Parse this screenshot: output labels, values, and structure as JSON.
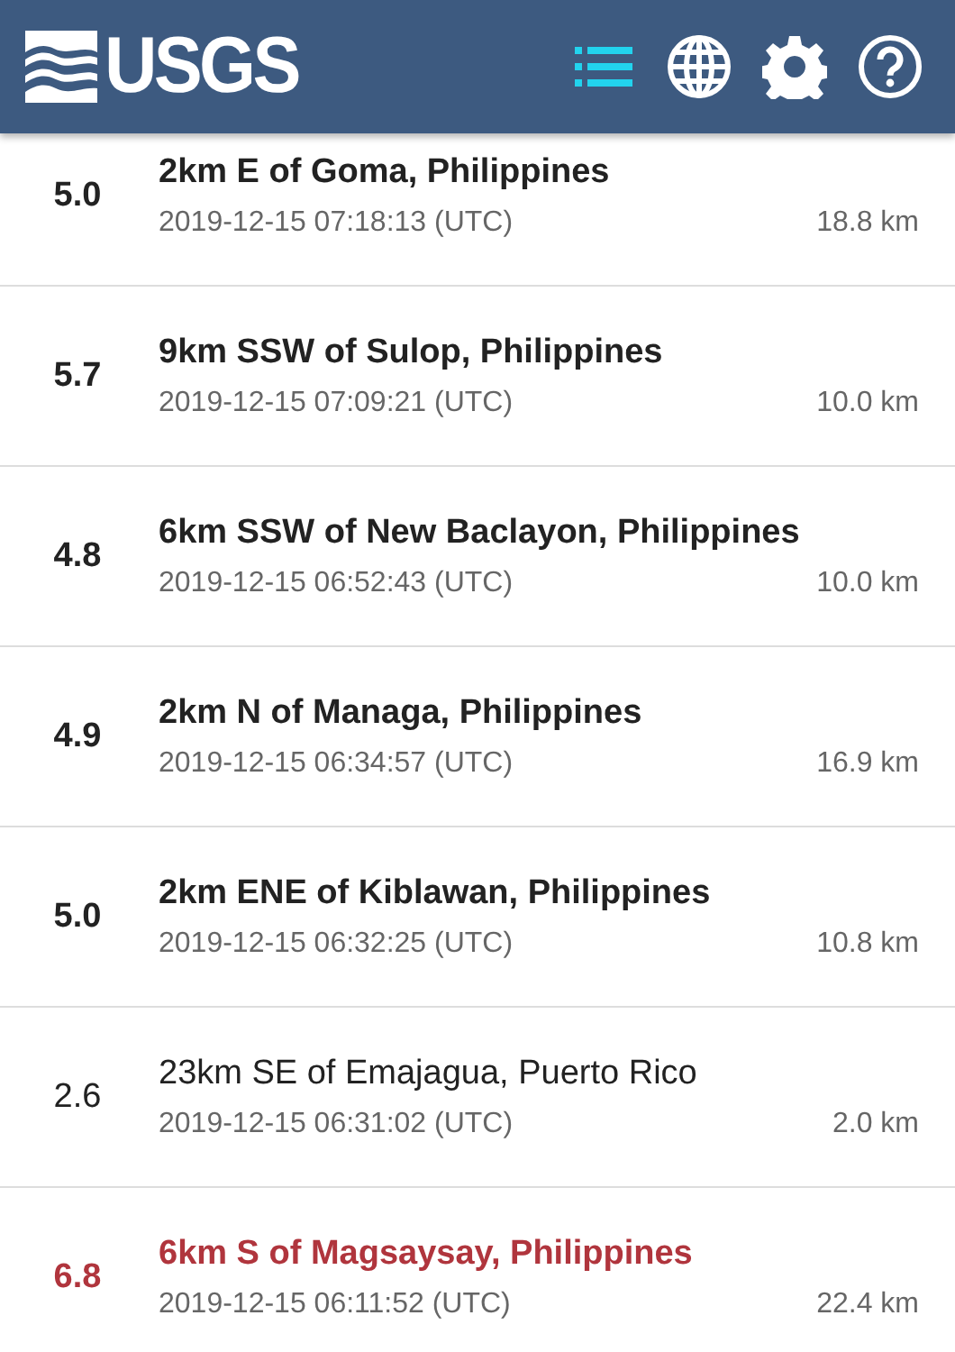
{
  "header": {
    "logo_text": "USGS",
    "nav": [
      {
        "selected": true
      },
      {
        "selected": false
      },
      {
        "selected": false
      },
      {
        "selected": false
      }
    ]
  },
  "earthquakes": [
    {
      "magnitude": "5.0",
      "place": "2km E of Goma, Philippines",
      "time": "2019-12-15 07:18:13 (UTC)",
      "depth": "18.8 km",
      "kind": "strong"
    },
    {
      "magnitude": "5.7",
      "place": "9km SSW of Sulop, Philippines",
      "time": "2019-12-15 07:09:21 (UTC)",
      "depth": "10.0 km",
      "kind": "strong"
    },
    {
      "magnitude": "4.8",
      "place": "6km SSW of New Baclayon, Philippines",
      "time": "2019-12-15 06:52:43 (UTC)",
      "depth": "10.0 km",
      "kind": "strong"
    },
    {
      "magnitude": "4.9",
      "place": "2km N of Managa, Philippines",
      "time": "2019-12-15 06:34:57 (UTC)",
      "depth": "16.9 km",
      "kind": "strong"
    },
    {
      "magnitude": "5.0",
      "place": "2km ENE of Kiblawan, Philippines",
      "time": "2019-12-15 06:32:25 (UTC)",
      "depth": "10.8 km",
      "kind": "strong"
    },
    {
      "magnitude": "2.6",
      "place": "23km SE of Emajagua, Puerto Rico",
      "time": "2019-12-15 06:31:02 (UTC)",
      "depth": "2.0 km",
      "kind": "minor"
    },
    {
      "magnitude": "6.8",
      "place": "6km S of Magsaysay, Philippines",
      "time": "2019-12-15 06:11:52 (UTC)",
      "depth": "22.4 km",
      "kind": "major"
    }
  ]
}
